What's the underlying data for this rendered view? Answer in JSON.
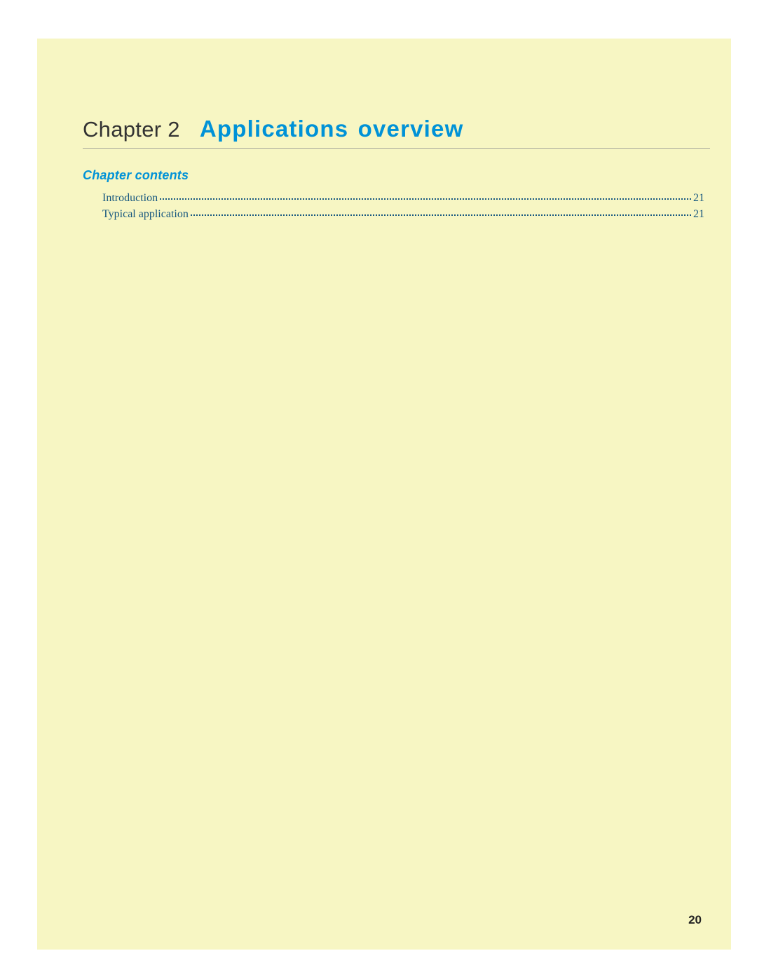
{
  "chapter": {
    "prefix": "Chapter 2",
    "title": "Applications overview"
  },
  "contents": {
    "heading": "Chapter contents",
    "items": [
      {
        "label": "Introduction",
        "page": "21"
      },
      {
        "label": "Typical application",
        "page": "21"
      }
    ]
  },
  "page_number": "20"
}
